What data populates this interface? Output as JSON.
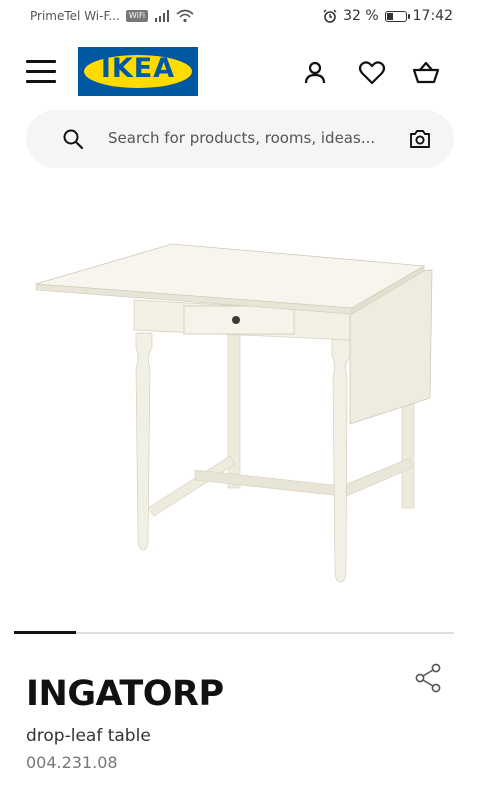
{
  "status_bar": {
    "carrier": "PrimeTel Wi-F...",
    "wifi_badge": "WiFi",
    "battery": "32 %",
    "time": "17:42"
  },
  "header": {
    "logo_text": "IKEA",
    "icons": [
      "menu-icon",
      "account-icon",
      "heart-icon",
      "basket-icon"
    ]
  },
  "search": {
    "placeholder": "Search for products, rooms, ideas..."
  },
  "product": {
    "name": "INGATORP",
    "description": "drop-leaf table",
    "article_number": "004.231.08"
  },
  "colors": {
    "ikea_blue": "#0058a3",
    "ikea_yellow": "#ffdb00",
    "search_bg": "#f5f5f5"
  }
}
